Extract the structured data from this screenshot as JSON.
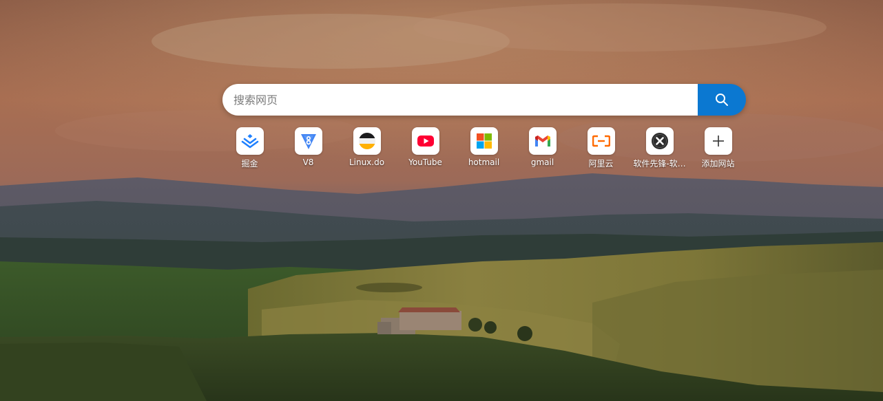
{
  "search": {
    "placeholder": "搜索网页",
    "button_color": "#0b78d1"
  },
  "shortcuts": [
    {
      "label": "掘金",
      "icon": "juejin-icon"
    },
    {
      "label": "V8",
      "icon": "v8-icon"
    },
    {
      "label": "Linux.do",
      "icon": "linuxdo-icon"
    },
    {
      "label": "YouTube",
      "icon": "youtube-icon"
    },
    {
      "label": "hotmail",
      "icon": "microsoft-icon"
    },
    {
      "label": "gmail",
      "icon": "gmail-icon"
    },
    {
      "label": "阿里云",
      "icon": "aliyun-icon"
    },
    {
      "label": "软件先锋-软…",
      "icon": "software-pioneer-icon"
    },
    {
      "label": "添加网站",
      "icon": "plus-icon"
    }
  ],
  "colors": {
    "youtube_red": "#ff0033",
    "aliyun_orange": "#ff6a00",
    "juejin_blue": "#1e80ff"
  }
}
